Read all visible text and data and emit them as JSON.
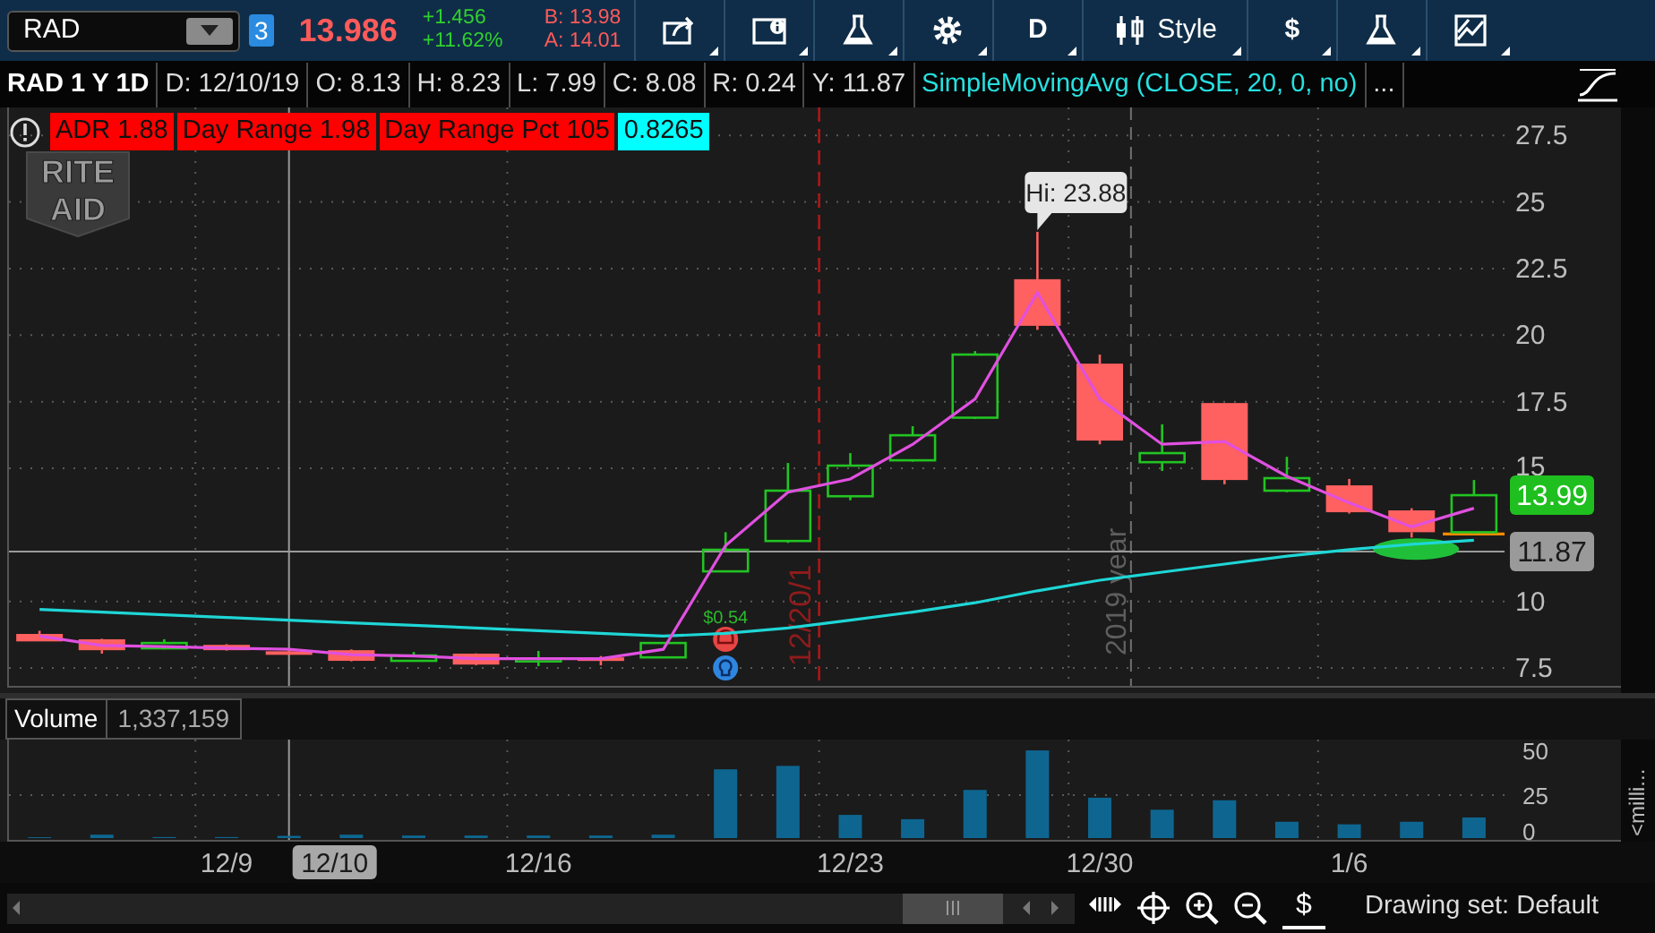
{
  "toolbar": {
    "symbol": "RAD",
    "link_badge": "3",
    "last": "13.986",
    "change": "+1.456",
    "change_pct": "+11.62%",
    "bid": "B: 13.98",
    "ask": "A: 14.01",
    "buttons": [
      {
        "kind": "share"
      },
      {
        "kind": "info"
      },
      {
        "kind": "flask"
      },
      {
        "kind": "gear"
      },
      {
        "kind": "text",
        "label": "D"
      },
      {
        "kind": "style",
        "label": "Style"
      },
      {
        "kind": "text",
        "label": "$"
      },
      {
        "kind": "flask"
      },
      {
        "kind": "drawing"
      }
    ]
  },
  "info_bar": {
    "title": "RAD 1 Y 1D",
    "fields": [
      "D: 12/10/19",
      "O: 8.13",
      "H: 8.23",
      "L: 7.99",
      "C: 8.08",
      "R: 0.24",
      "Y: 11.87"
    ],
    "study": "SimpleMovingAvg (CLOSE, 20, 0, no)",
    "more": "..."
  },
  "study_labels": [
    {
      "text": "ADR 1.88",
      "color": "#ff0000"
    },
    {
      "text": "Day Range 1.98",
      "color": "#ff0000"
    },
    {
      "text": "Day Range Pct 105",
      "color": "#ff0000"
    },
    {
      "text": "0.8265",
      "color": "#00ffff"
    }
  ],
  "logo": [
    "RITE",
    "AID"
  ],
  "price_chart": {
    "high_label": "Hi: 23.88",
    "dividend": "$0.54",
    "date_marker": "12/20/1",
    "year_marker": "2019 year",
    "last_price": "13.99",
    "chart_data": {
      "type": "line",
      "categories": [
        null,
        null,
        null,
        "12/9",
        null,
        null,
        null,
        null,
        "12/16",
        null,
        null,
        null,
        null,
        "12/23",
        null,
        null,
        null,
        "12/30",
        null,
        null,
        null,
        "1/6",
        null,
        null
      ],
      "ylim": [
        6.83,
        28.55
      ],
      "grid": true,
      "ref_lines": [
        {
          "axis": "y",
          "value": 11.87,
          "label": "11.87"
        }
      ],
      "yticks": [
        7.5,
        10,
        15,
        17.5,
        20,
        22.5,
        25,
        27.5
      ],
      "series": [
        {
          "color": "#1fd6d6",
          "values": [
            9.7,
            9.6,
            9.5,
            9.4,
            9.3,
            9.2,
            9.1,
            9.0,
            8.9,
            8.8,
            8.7,
            8.8,
            9.0,
            9.3,
            9.6,
            9.95,
            10.4,
            10.8,
            11.1,
            11.4,
            11.7,
            11.95,
            12.15,
            12.3
          ]
        },
        {
          "color": "#e050e0",
          "values": [
            8.7,
            8.35,
            8.3,
            8.25,
            8.2,
            8.0,
            7.95,
            7.85,
            7.85,
            7.85,
            8.2,
            12.1,
            14.1,
            14.6,
            15.9,
            17.6,
            21.6,
            17.6,
            15.9,
            16.0,
            14.7,
            13.7,
            12.8,
            13.5
          ]
        }
      ]
    }
  },
  "volume": {
    "title": "Volume",
    "value": "1,337,159",
    "units": "<milli...",
    "axis_labels": [
      "50",
      "25",
      "0"
    ]
  },
  "date_axis": {
    "cursor_date": "12/10"
  },
  "bottom_bar": {
    "dollar": "$",
    "drawing_set": "Drawing set: Default"
  }
}
